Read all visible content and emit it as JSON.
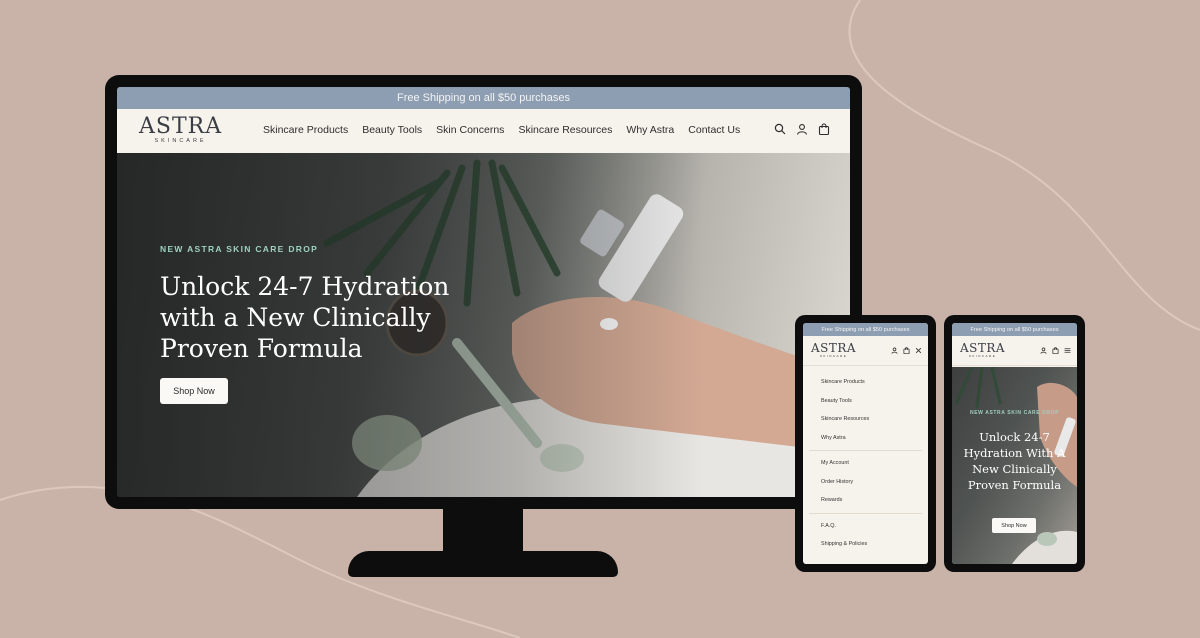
{
  "desktop": {
    "promo_text": "Free Shipping on all $50 purchases",
    "logo": {
      "word": "ASTRA",
      "sub": "SKINCARE"
    },
    "menu": [
      "Skincare Products",
      "Beauty Tools",
      "Skin Concerns",
      "Skincare Resources",
      "Why Astra",
      "Contact Us"
    ],
    "icons": [
      "search-icon",
      "account-icon",
      "cart-icon"
    ],
    "hero": {
      "eyebrow": "NEW ASTRA SKIN CARE DROP",
      "headline": "Unlock 24-7 Hydration with a New Clinically Proven Formula",
      "button": "Shop Now"
    }
  },
  "phone_menu": {
    "promo_text": "Free Shipping on all $50 purchases",
    "logo": {
      "word": "ASTRA",
      "sub": "SKINCARE"
    },
    "icons": [
      "account-icon",
      "cart-icon",
      "close-icon"
    ],
    "group1": [
      "Skincare Products",
      "Beauty Tools",
      "Skincare Resources",
      "Why Astra"
    ],
    "group2": [
      "My Account",
      "Order History",
      "Rewards"
    ],
    "group3": [
      "F.A.Q.",
      "Shipping & Policies"
    ]
  },
  "phone_home": {
    "promo_text": "Free Shipping on all $50 purchases",
    "logo": {
      "word": "ASTRA",
      "sub": "SKINCARE"
    },
    "icons": [
      "account-icon",
      "cart-icon",
      "hamburger-icon"
    ],
    "hero": {
      "eyebrow": "NEW ASTRA SKIN CARE DROP",
      "headline": "Unlock 24-7 Hydration With A New Clinically Proven Formula",
      "button": "Shop Now"
    }
  },
  "colors": {
    "background": "#c9b3a8",
    "device": "#0d0d0d",
    "promo_bar": "#8d9db2",
    "nav_bg": "#f6f2ec",
    "eyebrow": "#9fd0bf"
  }
}
